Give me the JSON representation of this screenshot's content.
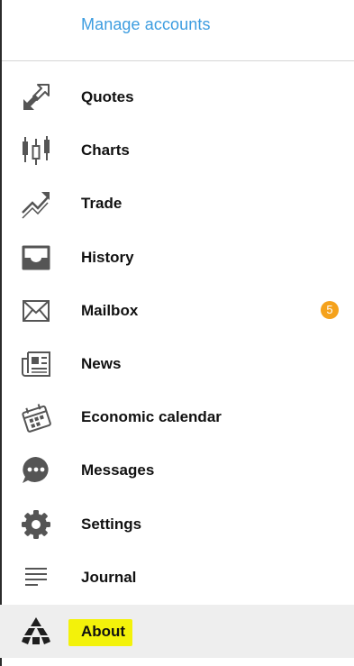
{
  "header": {
    "manage_accounts": "Manage accounts"
  },
  "menu": {
    "items": [
      {
        "label": "Quotes",
        "icon": "quotes-arrows-icon"
      },
      {
        "label": "Charts",
        "icon": "candlestick-chart-icon"
      },
      {
        "label": "Trade",
        "icon": "trade-trend-icon"
      },
      {
        "label": "History",
        "icon": "inbox-tray-icon"
      },
      {
        "label": "Mailbox",
        "icon": "envelope-icon",
        "badge": "5"
      },
      {
        "label": "News",
        "icon": "newspaper-icon"
      },
      {
        "label": "Economic calendar",
        "icon": "calendar-icon"
      },
      {
        "label": "Messages",
        "icon": "chat-bubble-icon"
      },
      {
        "label": "Settings",
        "icon": "gear-icon"
      },
      {
        "label": "Journal",
        "icon": "journal-lines-icon"
      },
      {
        "label": "About",
        "icon": "about-logo-icon",
        "active": true,
        "highlighted": true
      }
    ]
  },
  "colors": {
    "link": "#3d9de0",
    "badge": "#f5a21c",
    "highlight": "#f3f20a",
    "active_row": "#eeeeee",
    "icon": "#555555"
  }
}
